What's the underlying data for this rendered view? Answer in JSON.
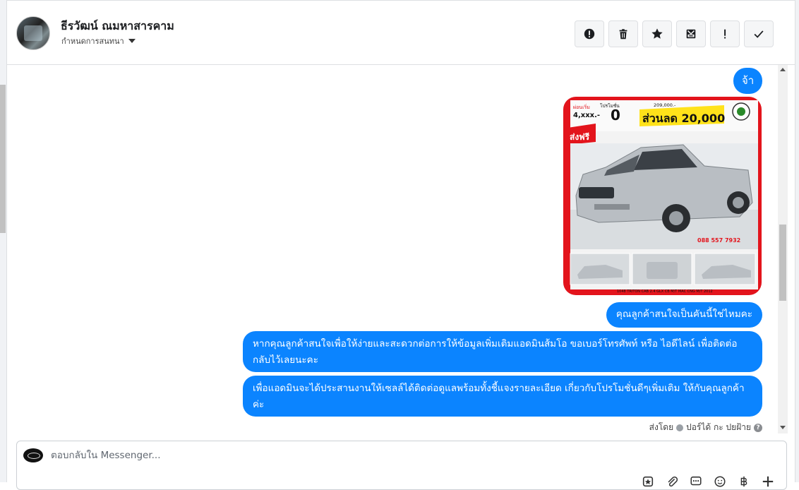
{
  "header": {
    "contact_name": "ธีรวัฒน์ ณมหาสารคาม",
    "assign_label": "กำหนดการสนทนา",
    "toolbar": [
      {
        "name": "report-icon",
        "label": "report"
      },
      {
        "name": "trash-icon",
        "label": "delete"
      },
      {
        "name": "star-icon",
        "label": "star"
      },
      {
        "name": "archive-icon",
        "label": "archive"
      },
      {
        "name": "exclamation-icon",
        "label": "important"
      },
      {
        "name": "check-icon",
        "label": "done"
      }
    ]
  },
  "messages": [
    {
      "type": "text",
      "text": "จ้า"
    },
    {
      "type": "image",
      "alt": "ad-image",
      "ad_texts": {
        "down": "ผ่อนเริ่ม",
        "down_value": "4,xxx.-",
        "interest": "โปรโมชั่น",
        "zero": "0",
        "price": "209,000.-",
        "discount": "ส่วนลด 20,000",
        "free": "ส่งฟรี",
        "phone": "088 557 7932",
        "model": "1048 TRITON CAB 2.4 GLX CB M/T MAC CNG M/T 2012"
      }
    },
    {
      "type": "text",
      "text": "คุณลูกค้าสนใจเป็นคันนี้ใช่ไหมคะ"
    },
    {
      "type": "text",
      "text": "หากคุณลูกค้าสนใจเพื่อให้ง่ายและสะดวกต่อการให้ข้อมูลเพิ่มเติมแอดมินส้มโอ ขอเบอร์โทรศัพท์ หรือ ไอดีไลน์ เพื่อติดต่อกลับไว้เลยนะคะ"
    },
    {
      "type": "text",
      "text": "เพื่อแอดมินจะได้ประสานงานให้เซลล์ได้ติดต่อดูแลพร้อมทั้งชี้แจงรายละเอียด เกี่ยวกับโปรโมชั่นดีๆเพิ่มเติม ให้กับคุณลูกค้าค่ะ"
    }
  ],
  "sent_by": {
    "prefix": "ส่งโดย",
    "name": "ปอร์ได้ กะ ปยฝ้าย"
  },
  "reply": {
    "placeholder": "ตอบกลับใน Messenger..."
  },
  "colors": {
    "bubble": "#0b84ff",
    "ad_red": "#e3141c",
    "ad_yellow": "#ffe21a"
  }
}
